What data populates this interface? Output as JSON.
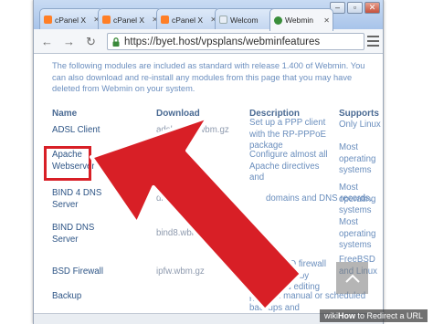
{
  "browser": {
    "tabs": [
      {
        "label": "cPanel X",
        "favicon": "cpanel-icon",
        "active": false
      },
      {
        "label": "cPanel X",
        "favicon": "cpanel-icon",
        "active": false
      },
      {
        "label": "cPanel X",
        "favicon": "cpanel-icon",
        "active": false
      },
      {
        "label": "Welcom",
        "favicon": "page-icon",
        "active": false
      },
      {
        "label": "Webmin",
        "favicon": "webmin-icon",
        "active": true
      }
    ],
    "url": "https://byet.host/vpsplans/webminfeatures",
    "window_controls": [
      "minimize-icon",
      "maximize-icon",
      "close-icon"
    ]
  },
  "page": {
    "intro": "The following modules are included as standard with release 1.400 of Webmin. You can also download and re-install any modules from this page that you may have deleted from Webmin on your system.",
    "table": {
      "headers": [
        "Name",
        "Download",
        "Description",
        "Supports"
      ],
      "rows": [
        {
          "name": "ADSL Client",
          "download": "adsl-client.wbm.gz",
          "description": "Set up a PPP client with the RP-PPPoE package",
          "supports": "Only Linux"
        },
        {
          "name": "Apache Webserver",
          "download": "",
          "description": "Configure almost all Apache directives and",
          "supports": "Most operating systems"
        },
        {
          "name": "BIND 4 DNS Server",
          "download": "dnsad",
          "description": "domains and DNS records.",
          "supports": "Most operating systems"
        },
        {
          "name": "BIND DNS Server",
          "download": "bind8.wbm.gz",
          "description": "",
          "supports": "Most operating systems"
        },
        {
          "name": "BSD Firewall",
          "download": "ipfw.wbm.gz",
          "description": "Co... a BSD firewall using IPFW, by crea... and editing rules",
          "supports": "FreeBSD and Linux"
        },
        {
          "name": "Backup",
          "download": "",
          "description": "Perform manual or scheduled backups and",
          "supports": ""
        }
      ]
    }
  },
  "watermark": {
    "brand": "wiki",
    "brand_bold": "How",
    "title": "to Redirect a URL"
  },
  "colors": {
    "arrow": "#d81f26",
    "arrow_outline": "#ffffff",
    "link": "#2e5586",
    "muted_text": "#6c8fbf"
  }
}
